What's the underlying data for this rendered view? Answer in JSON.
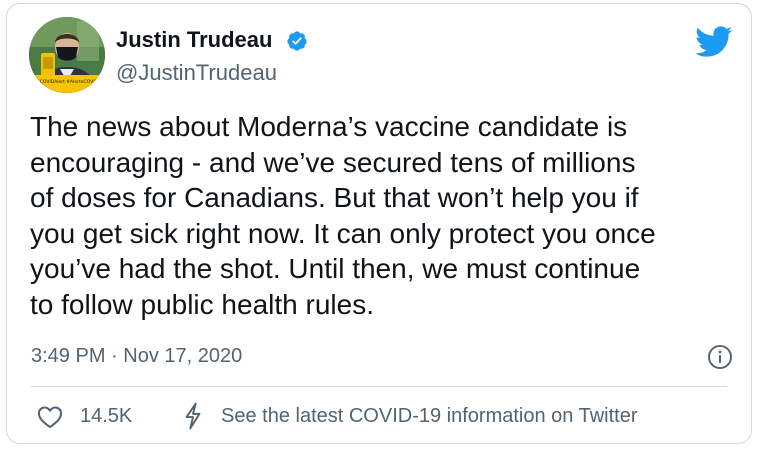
{
  "author": {
    "display_name": "Justin Trudeau",
    "handle": "@JustinTrudeau",
    "verified": true,
    "avatar_badge_text": "#COVIDAlert #AlerteCOVID"
  },
  "tweet": {
    "lines": [
      "The news about Moderna’s vaccine candidate is",
      "encouraging - and we’ve secured tens of millions",
      "of doses for Canadians. But that won’t help you if",
      "you get sick right now. It can only protect you once",
      "you’ve had the shot. Until then, we must continue",
      "to follow public health rules."
    ],
    "timestamp": "3:49 PM · Nov 17, 2020"
  },
  "actions": {
    "like_count": "14.5K",
    "covid_link": "See the latest COVID-19 information on Twitter"
  },
  "icons": {
    "brand": "twitter-bird-icon",
    "verified": "verified-badge-icon",
    "info": "info-icon",
    "like": "heart-icon",
    "covid": "lightning-bolt-icon"
  },
  "colors": {
    "twitter_blue": "#1d9bf0",
    "text_primary": "#0f1419",
    "text_secondary": "#536471",
    "border": "#cfd9de"
  }
}
